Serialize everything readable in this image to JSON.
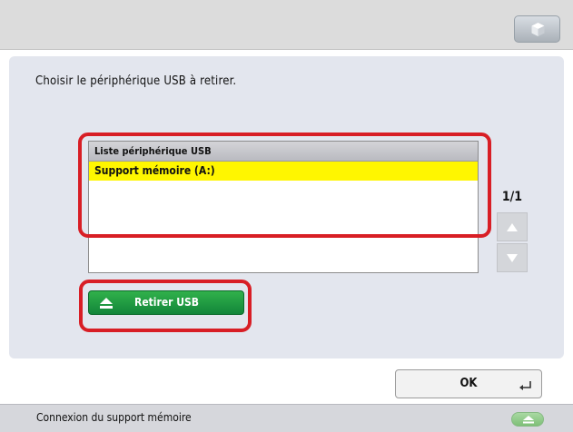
{
  "header": {
    "top_right_icon": "cube-icon"
  },
  "dialog": {
    "instruction": "Choisir le périphérique USB à retirer.",
    "list": {
      "header": "Liste périphérique USB",
      "items": [
        {
          "label": "Support mémoire (A:)",
          "selected": true
        }
      ]
    },
    "pagination": {
      "text": "1/1"
    },
    "remove_button": {
      "label": "Retirer USB",
      "icon": "eject-icon"
    }
  },
  "ok_button": {
    "label": "OK"
  },
  "status_bar": {
    "text": "Connexion du support mémoire",
    "icon": "eject-icon"
  },
  "colors": {
    "selection": "#fff600",
    "highlight": "#d81e25",
    "remove_button": "#1a9a40"
  }
}
